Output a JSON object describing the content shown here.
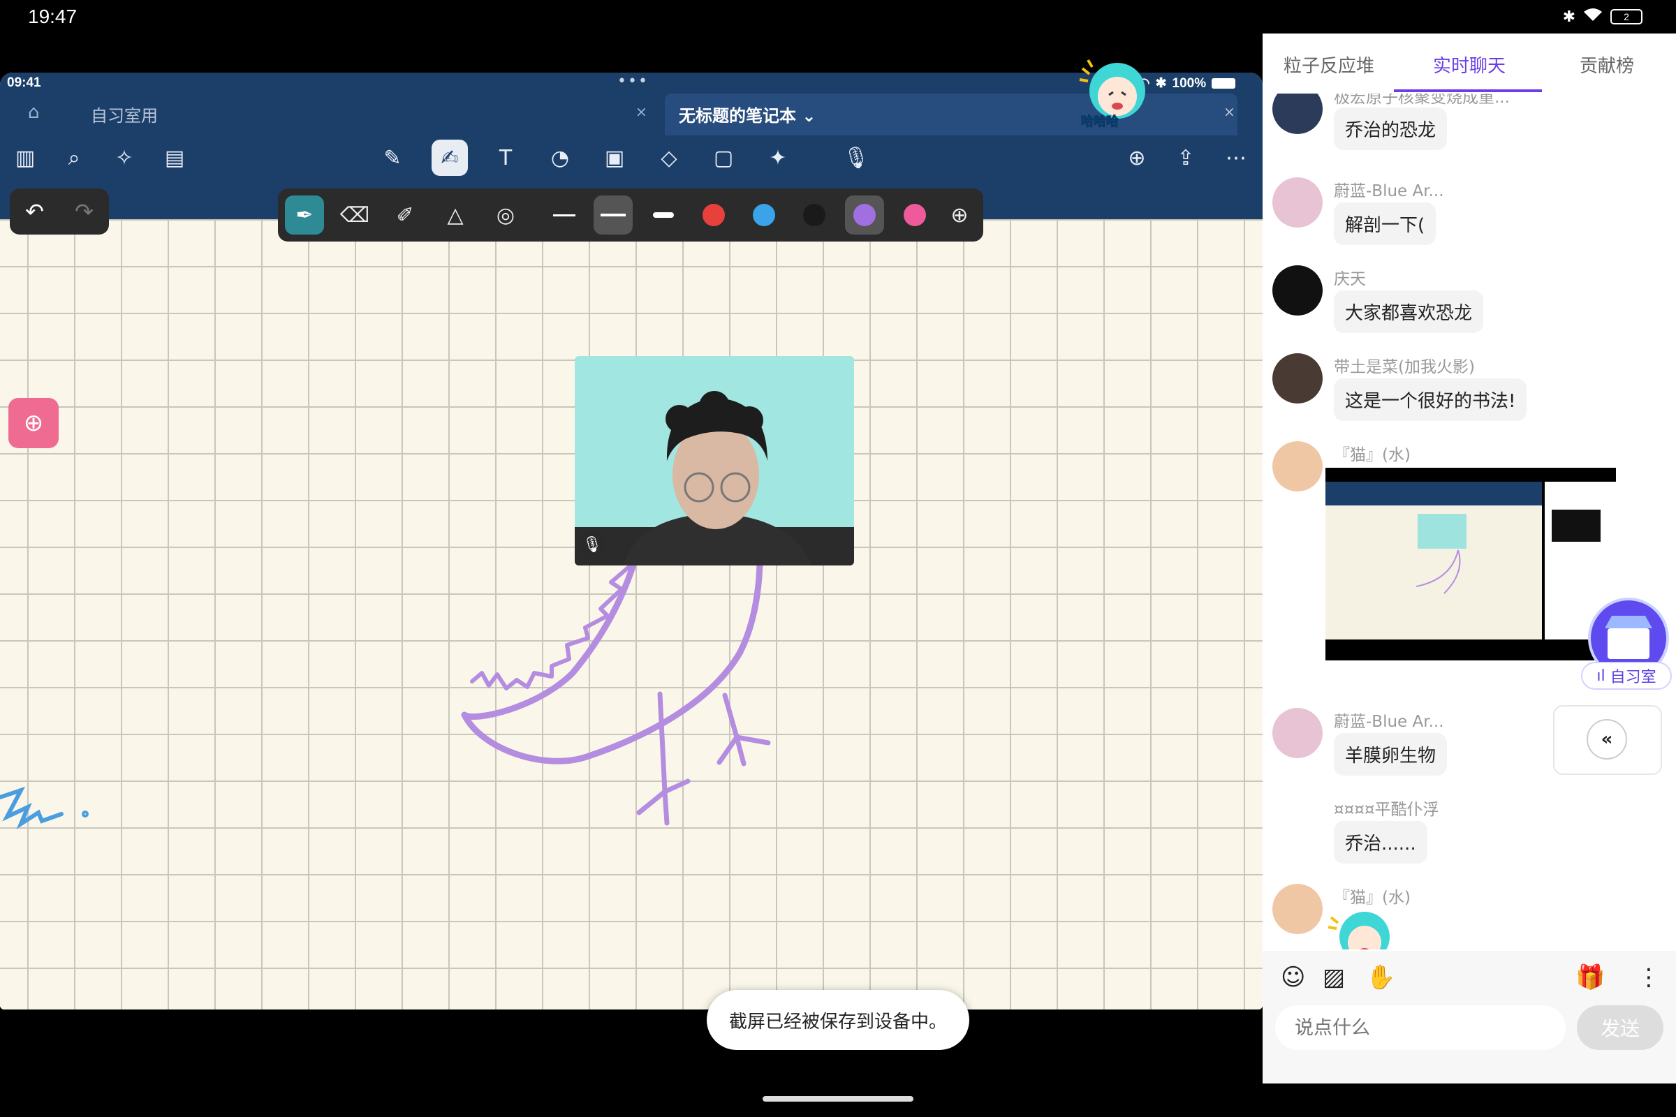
{
  "system": {
    "time": "19:47",
    "battery": "2"
  },
  "app": {
    "inner_time": "09:41",
    "inner_dots": "•••",
    "inner_battery": "100%",
    "tab_inactive": "自习室用",
    "tab_active": "无标题的笔记本",
    "tab_active_chevron": "⌄",
    "close_glyph": "×",
    "sticker_caption": "哈哈哈",
    "toast": "截屏已经被保存到设备中。",
    "pen_colors": [
      "#e8413b",
      "#3ba3ea",
      "#1a1a1a",
      "#a070e0",
      "#ef5a9a"
    ],
    "stroke_color": "#b48de0"
  },
  "panel": {
    "tabs": [
      "粒子反应堆",
      "实时聊天",
      "贡献榜"
    ],
    "active_tab": "实时聊天",
    "messages": [
      {
        "name": "极宏原子核聚变烧成重...",
        "text": "乔治的恐龙"
      },
      {
        "name": "蔚蓝-Blue Ar...",
        "text": "解剖一下("
      },
      {
        "name": "庆天",
        "text": "大家都喜欢恐龙"
      },
      {
        "name": "带土是菜(加我火影)",
        "text": "这是一个很好的书法!"
      },
      {
        "name": "『猫』(水)",
        "text": ""
      },
      {
        "name": "蔚蓝-Blue Ar...",
        "text": "羊膜卵生物"
      },
      {
        "name": "¤¤¤¤平酷仆浮",
        "text": "乔治......"
      },
      {
        "name": "『猫』(水)",
        "text": ""
      }
    ],
    "study_room_label": "自习室",
    "collapse_glyph": "«",
    "input_placeholder": "说点什么",
    "send_label": "发送"
  }
}
